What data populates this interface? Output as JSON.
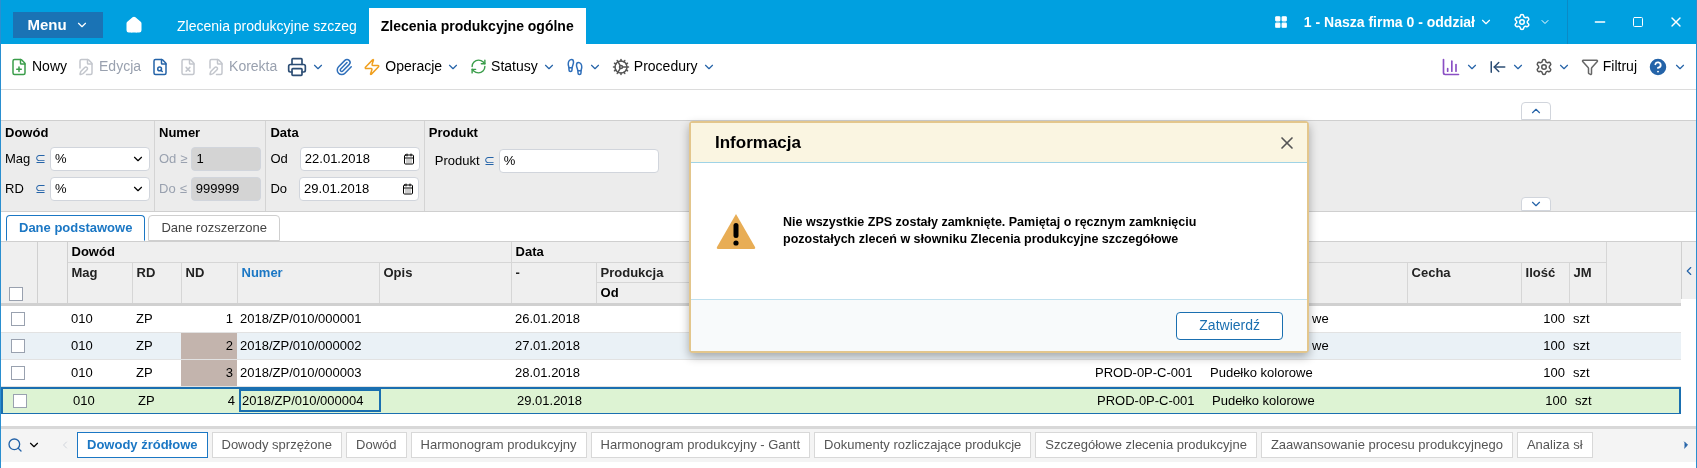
{
  "title_bar": {
    "menu": "Menu",
    "tabs": [
      {
        "label": "Zlecenia produkcyjne szczeg",
        "selected": false
      },
      {
        "label": "Zlecenia produkcyjne ogólne",
        "selected": true
      }
    ],
    "company": "1 - Nasza firma 0 - oddział"
  },
  "toolbar": {
    "left": [
      {
        "label": "Nowy",
        "disabled": false,
        "dropdown": false
      },
      {
        "label": "Edycja",
        "disabled": true,
        "dropdown": false
      },
      {
        "disabled": false,
        "dropdown": false
      },
      {
        "disabled": true,
        "dropdown": false
      },
      {
        "label": "Korekta",
        "disabled": true,
        "dropdown": false
      },
      {
        "disabled": false,
        "dropdown": true
      },
      {
        "disabled": false,
        "dropdown": false
      },
      {
        "label": "Operacje",
        "disabled": false,
        "dropdown": true
      },
      {
        "label": "Statusy",
        "disabled": false,
        "dropdown": true
      },
      {
        "disabled": false,
        "dropdown": true
      },
      {
        "label": "Procedury",
        "disabled": false,
        "dropdown": true
      }
    ],
    "right": [
      {
        "dropdown": true
      },
      {
        "dropdown": true
      },
      {
        "dropdown": true
      },
      {
        "label": "Filtruj",
        "dropdown": false
      },
      {
        "dropdown": true
      }
    ]
  },
  "filters": [
    {
      "title": "Dowód",
      "fields": [
        {
          "label": "Mag",
          "op": "⊆",
          "value": "%",
          "kind": "select",
          "disabled": false
        },
        {
          "label": "RD",
          "op": "⊆",
          "value": "%",
          "kind": "select",
          "disabled": false
        }
      ]
    },
    {
      "title": "Numer",
      "fields": [
        {
          "label": "Od",
          "op": "≥",
          "value": "1",
          "kind": "text",
          "disabled": true
        },
        {
          "label": "Do",
          "op": "≤",
          "value": "999999",
          "kind": "text",
          "disabled": true
        }
      ]
    },
    {
      "title": "Data",
      "fields": [
        {
          "label": "Od",
          "value": "22.01.2018",
          "kind": "date",
          "disabled": false
        },
        {
          "label": "Do",
          "value": "29.01.2018",
          "kind": "date",
          "disabled": false
        }
      ]
    },
    {
      "title": "Produkt",
      "fields": [
        {
          "label": "Produkt",
          "op": "⊆",
          "value": "%",
          "kind": "text",
          "disabled": false
        }
      ]
    }
  ],
  "view_tabs": [
    {
      "label": "Dane podstawowe",
      "selected": true
    },
    {
      "label": "Dane rozszerzone",
      "selected": false
    }
  ],
  "table": {
    "group_headers": [
      "Dowód",
      "Data"
    ],
    "select_all_checked": false,
    "columns": [
      {
        "label": "Mag",
        "sorted": false
      },
      {
        "label": "RD",
        "sorted": false
      },
      {
        "label": "ND",
        "sorted": false
      },
      {
        "label": "Numer",
        "sorted": true
      },
      {
        "label": "Opis",
        "sorted": false
      },
      {
        "label": "-",
        "sorted": false
      },
      {
        "label": "Produkcja",
        "sub_label": "Od",
        "sorted": false
      },
      {
        "label": "Cecha",
        "sorted": false
      },
      {
        "label": "Ilość",
        "sorted": false
      },
      {
        "label": "JM",
        "sorted": false
      }
    ],
    "rows": [
      {
        "checked": false,
        "selected": false,
        "mag": "010",
        "rd": "ZP",
        "nd": "1",
        "nd_marked": false,
        "numer": "2018/ZP/010/000001",
        "data": "26.01.2018",
        "nazwa": "we",
        "name_cut": true,
        "ilosc": "100",
        "jm": "szt"
      },
      {
        "checked": false,
        "selected": false,
        "mag": "010",
        "rd": "ZP",
        "nd": "2",
        "nd_marked": true,
        "numer": "2018/ZP/010/000002",
        "data": "27.01.2018",
        "nazwa": "we",
        "name_cut": true,
        "ilosc": "100",
        "jm": "szt"
      },
      {
        "checked": false,
        "selected": false,
        "mag": "010",
        "rd": "ZP",
        "nd": "3",
        "nd_marked": true,
        "numer": "2018/ZP/010/000003",
        "data": "28.01.2018",
        "kod": "PROD-0P-C-001",
        "nazwa": "Pudełko kolorowe",
        "name_cut": false,
        "ilosc": "100",
        "jm": "szt"
      },
      {
        "checked": false,
        "selected": true,
        "mag": "010",
        "rd": "ZP",
        "nd": "4",
        "nd_marked": false,
        "numer": "2018/ZP/010/000004",
        "data": "29.01.2018",
        "kod": "PROD-0P-C-001",
        "nazwa": "Pudełko kolorowe",
        "name_cut": false,
        "ilosc": "100",
        "jm": "szt"
      }
    ]
  },
  "bottom_tabs": [
    {
      "label": "Dowody źródłowe",
      "selected": true
    },
    {
      "label": "Dowody sprzężone",
      "selected": false
    },
    {
      "label": "Dowód",
      "selected": false
    },
    {
      "label": "Harmonogram produkcyjny",
      "selected": false
    },
    {
      "label": "Harmonogram produkcyjny - Gantt",
      "selected": false
    },
    {
      "label": "Dokumenty rozliczające produkcje",
      "selected": false
    },
    {
      "label": "Szczegółowe zlecenia produkcyjne",
      "selected": false
    },
    {
      "label": "Zaawansowanie procesu produkcyjnego",
      "selected": false
    },
    {
      "label": "Analiza sł",
      "selected": false
    }
  ],
  "dialog": {
    "title": "Informacja",
    "message": "Nie wszystkie ZPS zostały zamknięte. Pamiętaj o ręcznym zamknięciu pozostałych zleceń w słowniku Zlecenia produkcyjne szczegółowe",
    "button": "Zatwierdź"
  }
}
